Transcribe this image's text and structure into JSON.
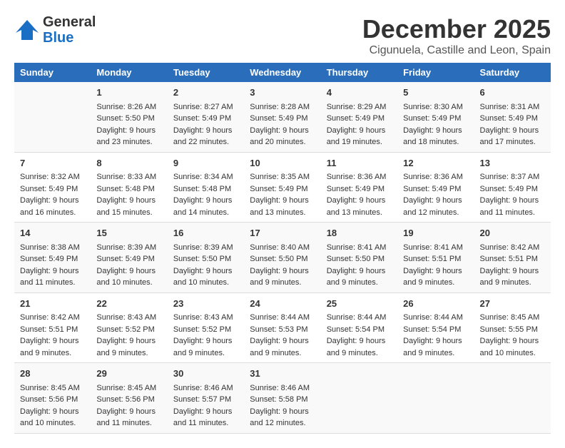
{
  "header": {
    "logo": {
      "line1": "General",
      "line2": "Blue"
    },
    "title": "December 2025",
    "location": "Cigunuela, Castille and Leon, Spain"
  },
  "calendar": {
    "weekdays": [
      "Sunday",
      "Monday",
      "Tuesday",
      "Wednesday",
      "Thursday",
      "Friday",
      "Saturday"
    ],
    "weeks": [
      [
        {
          "day": "",
          "info": ""
        },
        {
          "day": "1",
          "info": "Sunrise: 8:26 AM\nSunset: 5:50 PM\nDaylight: 9 hours\nand 23 minutes."
        },
        {
          "day": "2",
          "info": "Sunrise: 8:27 AM\nSunset: 5:49 PM\nDaylight: 9 hours\nand 22 minutes."
        },
        {
          "day": "3",
          "info": "Sunrise: 8:28 AM\nSunset: 5:49 PM\nDaylight: 9 hours\nand 20 minutes."
        },
        {
          "day": "4",
          "info": "Sunrise: 8:29 AM\nSunset: 5:49 PM\nDaylight: 9 hours\nand 19 minutes."
        },
        {
          "day": "5",
          "info": "Sunrise: 8:30 AM\nSunset: 5:49 PM\nDaylight: 9 hours\nand 18 minutes."
        },
        {
          "day": "6",
          "info": "Sunrise: 8:31 AM\nSunset: 5:49 PM\nDaylight: 9 hours\nand 17 minutes."
        }
      ],
      [
        {
          "day": "7",
          "info": "Sunrise: 8:32 AM\nSunset: 5:49 PM\nDaylight: 9 hours\nand 16 minutes."
        },
        {
          "day": "8",
          "info": "Sunrise: 8:33 AM\nSunset: 5:48 PM\nDaylight: 9 hours\nand 15 minutes."
        },
        {
          "day": "9",
          "info": "Sunrise: 8:34 AM\nSunset: 5:48 PM\nDaylight: 9 hours\nand 14 minutes."
        },
        {
          "day": "10",
          "info": "Sunrise: 8:35 AM\nSunset: 5:49 PM\nDaylight: 9 hours\nand 13 minutes."
        },
        {
          "day": "11",
          "info": "Sunrise: 8:36 AM\nSunset: 5:49 PM\nDaylight: 9 hours\nand 13 minutes."
        },
        {
          "day": "12",
          "info": "Sunrise: 8:36 AM\nSunset: 5:49 PM\nDaylight: 9 hours\nand 12 minutes."
        },
        {
          "day": "13",
          "info": "Sunrise: 8:37 AM\nSunset: 5:49 PM\nDaylight: 9 hours\nand 11 minutes."
        }
      ],
      [
        {
          "day": "14",
          "info": "Sunrise: 8:38 AM\nSunset: 5:49 PM\nDaylight: 9 hours\nand 11 minutes."
        },
        {
          "day": "15",
          "info": "Sunrise: 8:39 AM\nSunset: 5:49 PM\nDaylight: 9 hours\nand 10 minutes."
        },
        {
          "day": "16",
          "info": "Sunrise: 8:39 AM\nSunset: 5:50 PM\nDaylight: 9 hours\nand 10 minutes."
        },
        {
          "day": "17",
          "info": "Sunrise: 8:40 AM\nSunset: 5:50 PM\nDaylight: 9 hours\nand 9 minutes."
        },
        {
          "day": "18",
          "info": "Sunrise: 8:41 AM\nSunset: 5:50 PM\nDaylight: 9 hours\nand 9 minutes."
        },
        {
          "day": "19",
          "info": "Sunrise: 8:41 AM\nSunset: 5:51 PM\nDaylight: 9 hours\nand 9 minutes."
        },
        {
          "day": "20",
          "info": "Sunrise: 8:42 AM\nSunset: 5:51 PM\nDaylight: 9 hours\nand 9 minutes."
        }
      ],
      [
        {
          "day": "21",
          "info": "Sunrise: 8:42 AM\nSunset: 5:51 PM\nDaylight: 9 hours\nand 9 minutes."
        },
        {
          "day": "22",
          "info": "Sunrise: 8:43 AM\nSunset: 5:52 PM\nDaylight: 9 hours\nand 9 minutes."
        },
        {
          "day": "23",
          "info": "Sunrise: 8:43 AM\nSunset: 5:52 PM\nDaylight: 9 hours\nand 9 minutes."
        },
        {
          "day": "24",
          "info": "Sunrise: 8:44 AM\nSunset: 5:53 PM\nDaylight: 9 hours\nand 9 minutes."
        },
        {
          "day": "25",
          "info": "Sunrise: 8:44 AM\nSunset: 5:54 PM\nDaylight: 9 hours\nand 9 minutes."
        },
        {
          "day": "26",
          "info": "Sunrise: 8:44 AM\nSunset: 5:54 PM\nDaylight: 9 hours\nand 9 minutes."
        },
        {
          "day": "27",
          "info": "Sunrise: 8:45 AM\nSunset: 5:55 PM\nDaylight: 9 hours\nand 10 minutes."
        }
      ],
      [
        {
          "day": "28",
          "info": "Sunrise: 8:45 AM\nSunset: 5:56 PM\nDaylight: 9 hours\nand 10 minutes."
        },
        {
          "day": "29",
          "info": "Sunrise: 8:45 AM\nSunset: 5:56 PM\nDaylight: 9 hours\nand 11 minutes."
        },
        {
          "day": "30",
          "info": "Sunrise: 8:46 AM\nSunset: 5:57 PM\nDaylight: 9 hours\nand 11 minutes."
        },
        {
          "day": "31",
          "info": "Sunrise: 8:46 AM\nSunset: 5:58 PM\nDaylight: 9 hours\nand 12 minutes."
        },
        {
          "day": "",
          "info": ""
        },
        {
          "day": "",
          "info": ""
        },
        {
          "day": "",
          "info": ""
        }
      ]
    ]
  }
}
